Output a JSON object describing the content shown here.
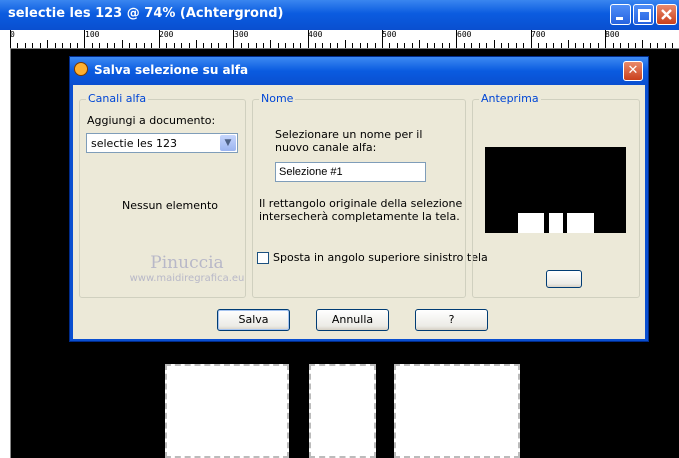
{
  "window": {
    "title": "selectie les 123 @  74% (Achtergrond)"
  },
  "ruler": {
    "labels": [
      "0",
      "100",
      "200",
      "300",
      "400",
      "500",
      "600",
      "700",
      "800"
    ]
  },
  "dialog": {
    "title": "Salva selezione su alfa",
    "close_glyph": "✕",
    "canali": {
      "legend": "Canali alfa",
      "add_label": "Aggiungi a documento:",
      "document_value": "selectie les 123",
      "empty_text": "Nessun elemento"
    },
    "nome": {
      "legend": "Nome",
      "prompt_line1": "Selezionare un nome per il",
      "prompt_line2": "nuovo canale alfa:",
      "name_value": "Selezione #1",
      "info_line1": "Il rettangolo originale della selezione",
      "info_line2": "intersecherà completamente la tela.",
      "checkbox_label": "Sposta in angolo superiore sinistro tela"
    },
    "anteprima": {
      "legend": "Anteprima"
    },
    "buttons": {
      "save": "Salva",
      "cancel": "Annulla",
      "help": "?"
    }
  },
  "watermark": {
    "line1": "Pinuccia",
    "line2": "www.maidiregrafica.eu"
  }
}
